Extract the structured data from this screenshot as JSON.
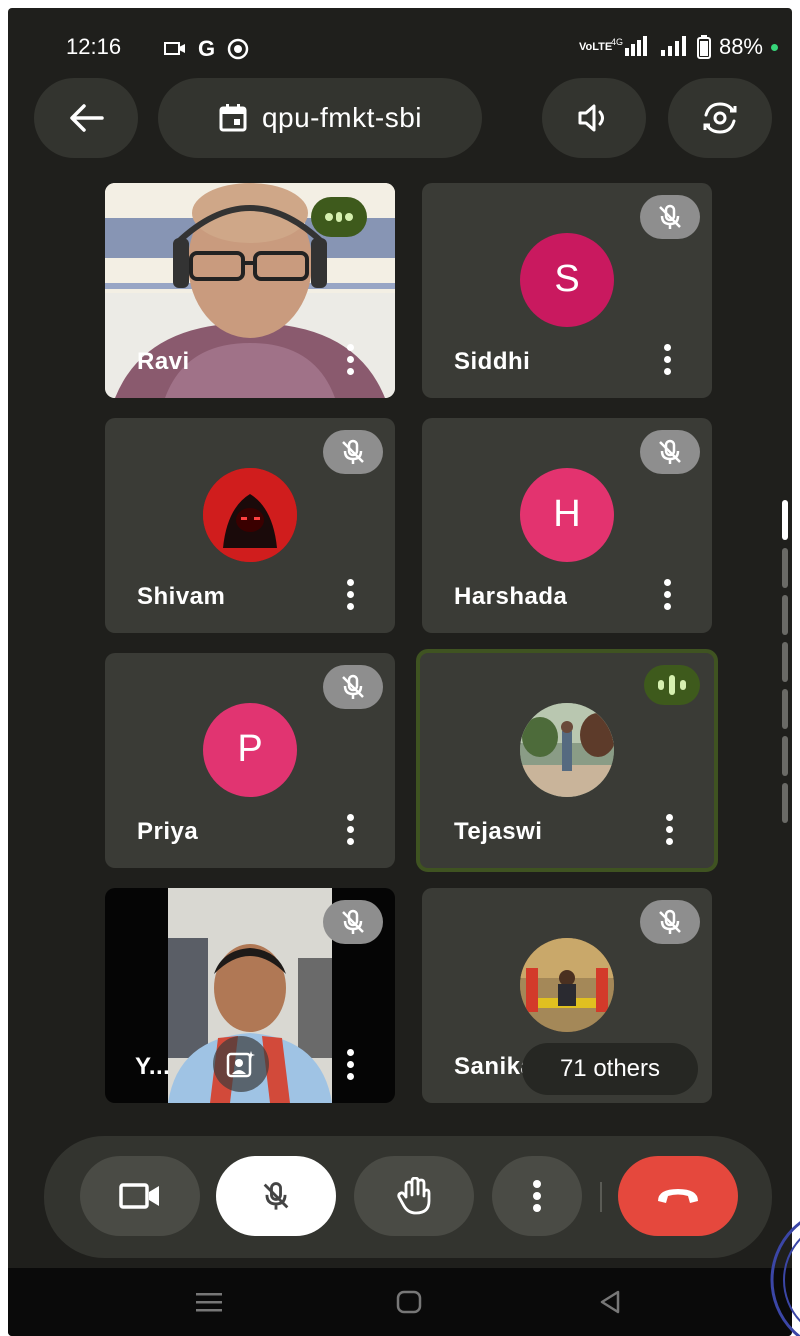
{
  "status_bar": {
    "time": "12:16",
    "battery": "88%",
    "carrier_tag": "VoLTE"
  },
  "header": {
    "meeting_code": "qpu-fmkt-sbi"
  },
  "participants": [
    {
      "name": "Ravi",
      "state": "speaking-video"
    },
    {
      "name": "Siddhi",
      "initial": "S",
      "avatar_color": "#c9195f",
      "state": "muted"
    },
    {
      "name": "Shivam",
      "state": "muted"
    },
    {
      "name": "Harshada",
      "initial": "H",
      "avatar_color": "#e3336f",
      "state": "muted"
    },
    {
      "name": "Priya",
      "initial": "P",
      "avatar_color": "#e13471",
      "state": "muted"
    },
    {
      "name": "Tejaswi",
      "state": "speaking"
    },
    {
      "name": "Y...",
      "state": "muted-video"
    },
    {
      "name": "Sanika",
      "state": "muted"
    }
  ],
  "others_chip": "71 others",
  "controls": {
    "camera": "camera-icon",
    "mic": "mic-off-icon",
    "raise_hand": "hand-icon",
    "more": "more-vert-icon",
    "end_call": "phone-end-icon"
  },
  "colors": {
    "accent_speaking": "#3e5a1c",
    "end_call": "#e5483d",
    "tile_bg": "#3a3b36"
  }
}
